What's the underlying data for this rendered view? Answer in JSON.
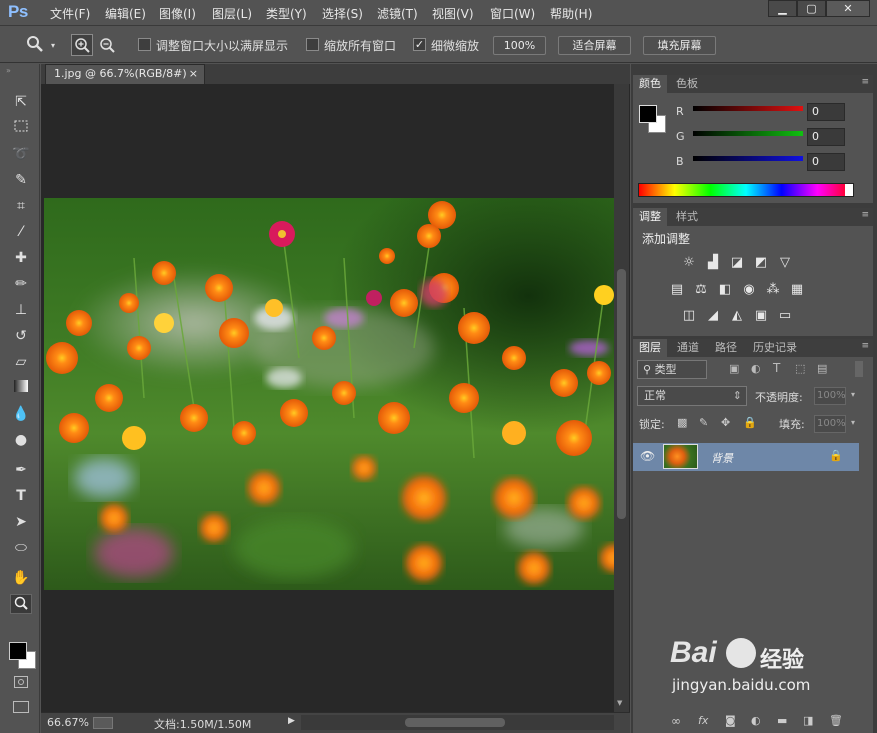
{
  "app": {
    "logo": "Ps"
  },
  "menu": [
    "文件(F)",
    "编辑(E)",
    "图像(I)",
    "图层(L)",
    "类型(Y)",
    "选择(S)",
    "滤镜(T)",
    "视图(V)",
    "窗口(W)",
    "帮助(H)"
  ],
  "window_controls": [
    "▁",
    "▢",
    "✕"
  ],
  "options": {
    "resize_windows_label": "调整窗口大小以满屏显示",
    "zoom_all_label": "缩放所有窗口",
    "scrubby_label": "细微缩放",
    "btn_100": "100%",
    "btn_fit": "适合屏幕",
    "btn_fill": "填充屏幕"
  },
  "document": {
    "tab_title": "1.jpg @ 66.7%(RGB/8#)",
    "close": "×"
  },
  "status": {
    "zoom": "66.67%",
    "doc_size": "文档:1.50M/1.50M"
  },
  "color_panel": {
    "tabs": [
      "颜色",
      "色板"
    ],
    "channels": [
      {
        "label": "R",
        "value": "0",
        "color": "#e01010"
      },
      {
        "label": "G",
        "value": "0",
        "color": "#10c010"
      },
      {
        "label": "B",
        "value": "0",
        "color": "#1010e0"
      }
    ]
  },
  "adjust_panel": {
    "tabs": [
      "调整",
      "样式"
    ],
    "title": "添加调整"
  },
  "layers_panel": {
    "tabs": [
      "图层",
      "通道",
      "路径",
      "历史记录"
    ],
    "filter_label": "类型",
    "blend_mode": "正常",
    "opacity_label": "不透明度:",
    "opacity_value": "100%",
    "lock_label": "锁定:",
    "fill_label": "填充:",
    "fill_value": "100%",
    "layers": [
      {
        "name": "背景",
        "visible": true,
        "locked": true
      }
    ]
  },
  "watermark": {
    "brand": "Bai",
    "brand2": "经验",
    "url": "jingyan.baidu.com"
  },
  "colors": {
    "accent": "#8fc0ff",
    "layer_selected": "#6e87a8",
    "canvas_bg": "#282828"
  }
}
